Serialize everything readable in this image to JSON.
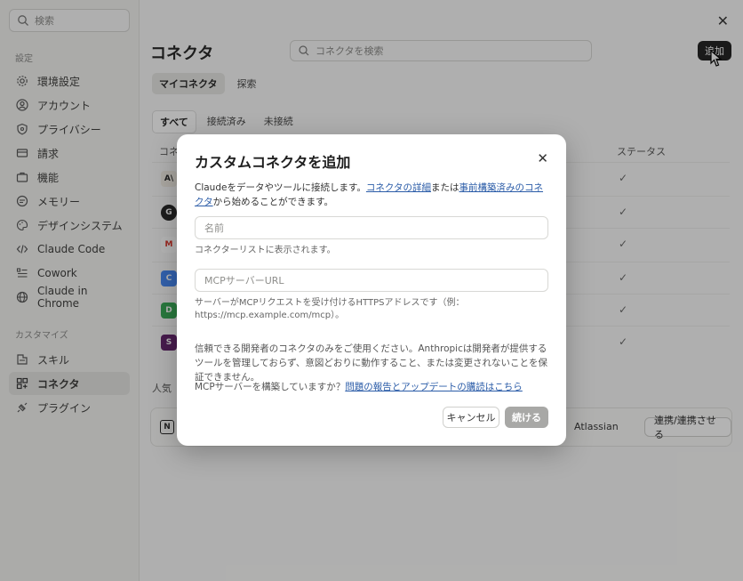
{
  "sidebar": {
    "search_placeholder": "検索",
    "section_settings": "設定",
    "settings_items": [
      {
        "label": "環境設定",
        "icon": "gear-icon"
      },
      {
        "label": "アカウント",
        "icon": "user-icon"
      },
      {
        "label": "プライバシー",
        "icon": "shield-icon"
      },
      {
        "label": "請求",
        "icon": "card-icon"
      },
      {
        "label": "機能",
        "icon": "briefcase-icon"
      },
      {
        "label": "メモリー",
        "icon": "memory-icon"
      },
      {
        "label": "デザインシステム",
        "icon": "palette-icon"
      },
      {
        "label": "Claude Code",
        "icon": "code-icon"
      },
      {
        "label": "Cowork",
        "icon": "list-icon"
      },
      {
        "label": "Claude in Chrome",
        "icon": "globe-icon"
      }
    ],
    "section_customize": "カスタマイズ",
    "customize_items": [
      {
        "label": "スキル",
        "icon": "skill-icon"
      },
      {
        "label": "コネクタ",
        "icon": "grid-icon"
      },
      {
        "label": "プラグイン",
        "icon": "plugin-icon"
      }
    ]
  },
  "main": {
    "title": "コネクタ",
    "search_placeholder": "コネクタを検索",
    "add_label": "追加",
    "tabs": [
      "マイコネクタ",
      "探索"
    ],
    "filters": [
      "すべて",
      "接続済み",
      "未接続"
    ],
    "col_connector": "コネ",
    "col_status": "ステータス",
    "rows": [
      {
        "logo": "A\\",
        "check": "✓"
      },
      {
        "logo": "G",
        "check": "✓"
      },
      {
        "logo": "M",
        "check": "✓"
      },
      {
        "logo": "C",
        "check": "✓"
      },
      {
        "logo": "D",
        "check": "✓"
      },
      {
        "logo": "S",
        "check": "✓"
      }
    ],
    "popular_label": "人気",
    "popular": {
      "logo": "N",
      "vendor": "Atlassian",
      "button": "連携/連携させる"
    }
  },
  "modal": {
    "title": "カスタムコネクタを追加",
    "desc_prefix": "Claudeをデータやツールに接続します。",
    "desc_link1": "コネクタの詳細",
    "desc_mid": "または",
    "desc_link2": "事前構築済みのコネクタ",
    "desc_suffix": "から始めることができます。",
    "name_placeholder": "名前",
    "name_hint": "コネクターリストに表示されます。",
    "url_placeholder": "MCPサーバーURL",
    "url_hint": "サーバーがMCPリクエストを受け付けるHTTPSアドレスです（例：https://mcp.example.com/mcp）。",
    "warning": "信頼できる開発者のコネクタのみをご使用ください。Anthropicは開発者が提供するツールを管理しておらず、意図どおりに動作すること、または変更されないことを保証できません。",
    "mcp_question": "MCPサーバーを構築していますか？",
    "mcp_link": "問題の報告とアップデートの購読はこちら",
    "cancel": "キャンセル",
    "continue": "続ける"
  }
}
